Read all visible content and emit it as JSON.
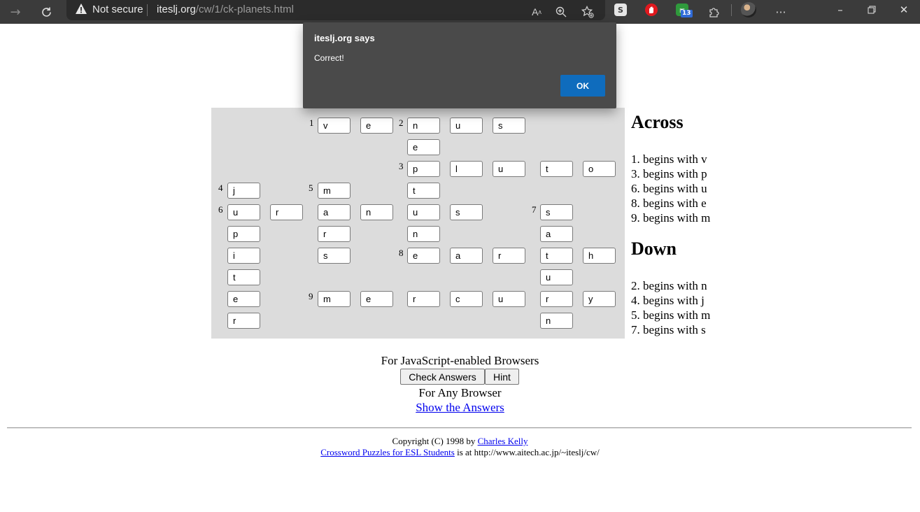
{
  "browser": {
    "security_label": "Not secure",
    "url_host": "iteslj.org",
    "url_path": "/cw/1/ck-planets.html",
    "extension_badge": "13",
    "ext_s_label": "S"
  },
  "dialog": {
    "title": "iteslj.org says",
    "message": "Correct!",
    "ok_label": "OK"
  },
  "crossword": {
    "numbers": [
      "1",
      "2",
      "3",
      "4",
      "5",
      "6",
      "7",
      "8",
      "9"
    ],
    "rows": [
      [
        "v",
        "e",
        "n",
        "u",
        "s"
      ],
      [
        "e"
      ],
      [
        "p",
        "l",
        "u",
        "t",
        "o"
      ],
      [
        "j",
        "m",
        "t"
      ],
      [
        "u",
        "r",
        "a",
        "n",
        "u",
        "s",
        "s"
      ],
      [
        "p",
        "r",
        "n",
        "a"
      ],
      [
        "i",
        "s",
        "e",
        "a",
        "r",
        "t",
        "h"
      ],
      [
        "t",
        "u"
      ],
      [
        "e",
        "m",
        "e",
        "r",
        "c",
        "u",
        "r",
        "y"
      ],
      [
        "r",
        "n"
      ]
    ]
  },
  "clues": {
    "across_title": "Across",
    "across": [
      "1. begins with v",
      "3. begins with p",
      "6. begins with u",
      "8. begins with e",
      "9. begins with m"
    ],
    "down_title": "Down",
    "down": [
      "2. begins with n",
      "4. begins with j",
      "5. begins with m",
      "7. begins with s"
    ]
  },
  "controls": {
    "js_label": "For JavaScript-enabled Browsers",
    "check_label": "Check Answers",
    "hint_label": "Hint",
    "any_label": "For Any Browser",
    "show_label": "Show the Answers"
  },
  "footer": {
    "copyright_prefix": "Copyright (C) 1998 by",
    "author": "Charles Kelly",
    "puzzles_link": "Crossword Puzzles for ESL Students",
    "location_text": "is at http://www.aitech.ac.jp/~iteslj/cw/"
  }
}
